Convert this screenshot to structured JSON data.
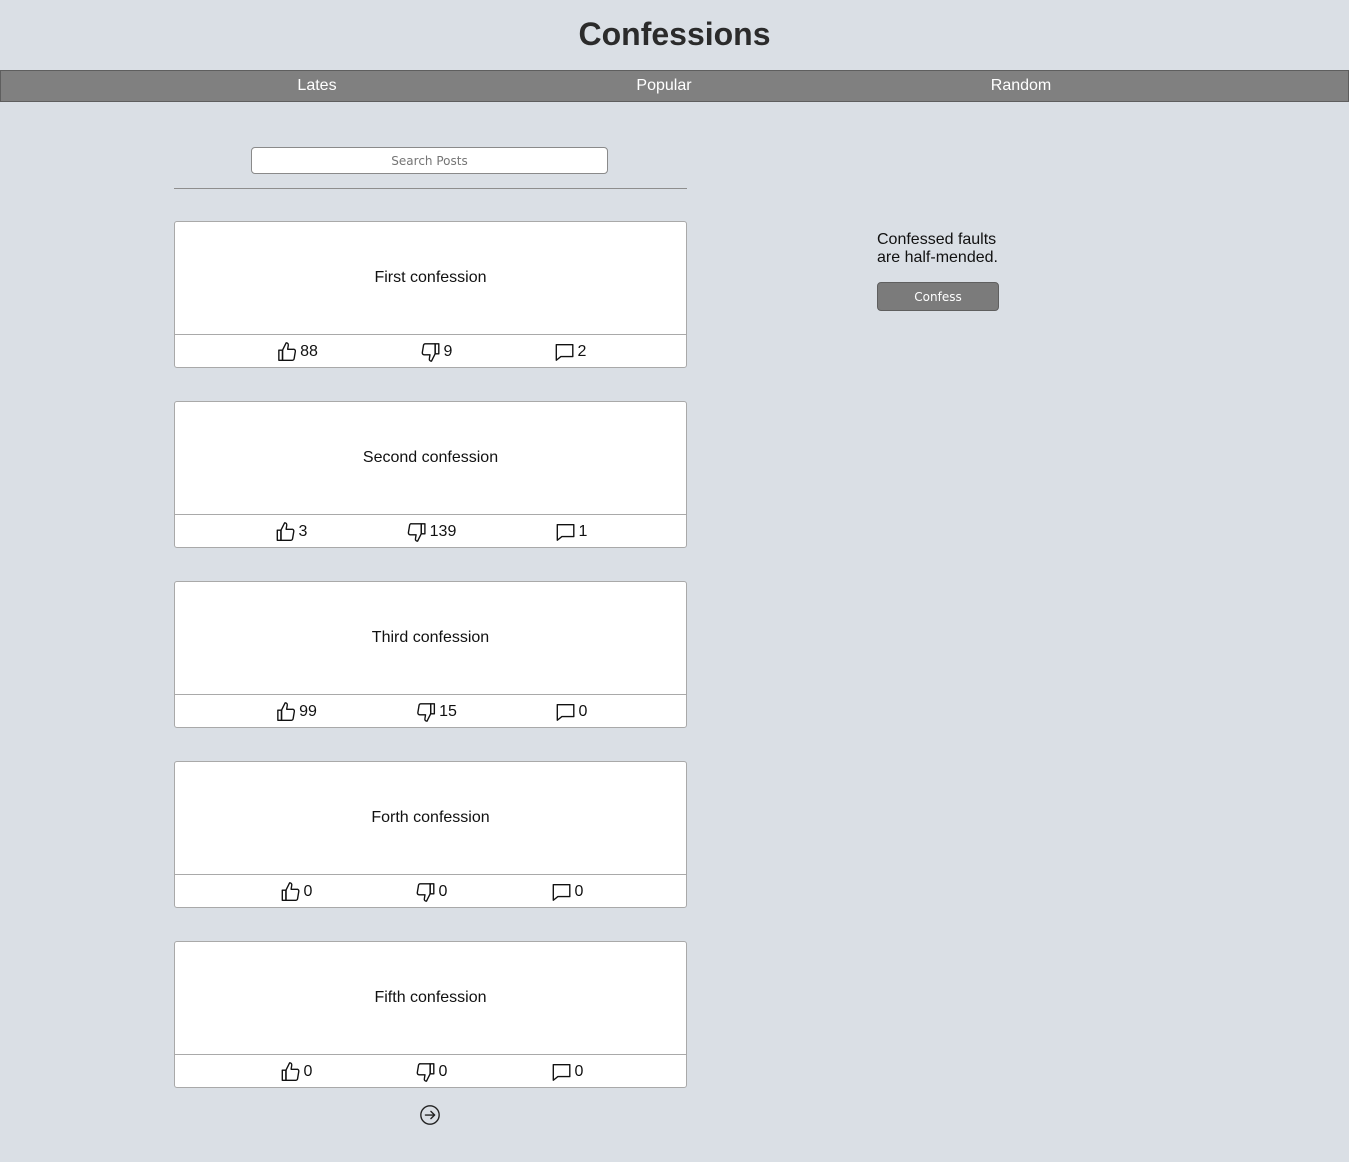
{
  "header": {
    "title": "Confessions"
  },
  "nav": {
    "items": [
      {
        "label": "Lates"
      },
      {
        "label": "Popular"
      },
      {
        "label": "Random"
      }
    ]
  },
  "search": {
    "placeholder": "Search Posts",
    "value": ""
  },
  "posts": [
    {
      "title": "First confession",
      "likes": "88",
      "dislikes": "9",
      "comments": "2"
    },
    {
      "title": "Second confession",
      "likes": "3",
      "dislikes": "139",
      "comments": "1"
    },
    {
      "title": "Third confession",
      "likes": "99",
      "dislikes": "15",
      "comments": "0"
    },
    {
      "title": "Forth confession",
      "likes": "0",
      "dislikes": "0",
      "comments": "0"
    },
    {
      "title": "Fifth confession",
      "likes": "0",
      "dislikes": "0",
      "comments": "0"
    }
  ],
  "sidebar": {
    "quote": "Confessed faults are half-mended.",
    "button_label": "Confess"
  },
  "icons": {
    "like": "thumbs-up-icon",
    "dislike": "thumbs-down-icon",
    "comment": "comment-icon",
    "next": "arrow-right-circle-icon"
  }
}
